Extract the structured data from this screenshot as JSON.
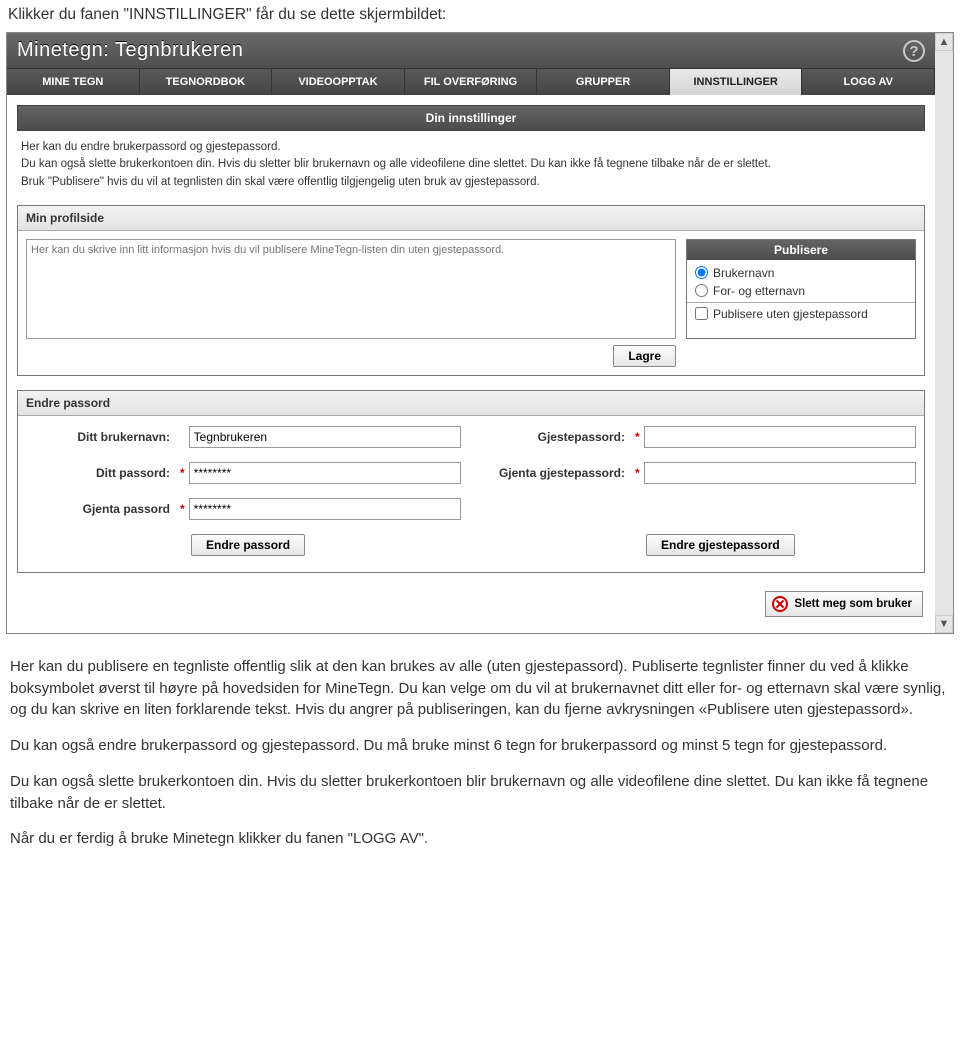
{
  "doc": {
    "intro": "Klikker du fanen \"INNSTILLINGER\" får du se dette skjermbildet:",
    "p1": "Her kan du publisere en tegnliste offentlig slik at den kan brukes av alle (uten gjestepassord). Publiserte tegnlister finner du ved å klikke boksymbolet øverst til høyre på hovedsiden for MineTegn. Du kan velge om du vil at brukernavnet ditt eller for- og etternavn skal være synlig, og du kan skrive en liten forklarende tekst. Hvis du angrer på publiseringen, kan du fjerne avkrysningen «Publisere uten gjestepassord».",
    "p2": "Du kan også endre brukerpassord og gjestepassord. Du må bruke minst 6 tegn for brukerpassord og minst 5 tegn for gjestepassord.",
    "p3": "Du kan også slette brukerkontoen din. Hvis du sletter brukerkontoen blir brukernavn og alle videofilene dine slettet. Du kan ikke få tegnene tilbake når de er slettet.",
    "p4": "Når du er ferdig å bruke Minetegn klikker du fanen \"LOGG AV\"."
  },
  "app": {
    "title": "Minetegn: Tegnbrukeren",
    "help": "?",
    "tabs": [
      "MINE TEGN",
      "TEGNORDBOK",
      "VIDEOOPPTAK",
      "FIL OVERFØRING",
      "GRUPPER",
      "INNSTILLINGER",
      "LOGG AV"
    ],
    "section_header": "Din innstillinger",
    "info": [
      "Her kan du endre brukerpassord og gjestepassord.",
      "Du kan også slette brukerkontoen din. Hvis du sletter blir brukernavn og alle videofilene dine slettet. Du kan ikke få tegnene tilbake når de er slettet.",
      "Bruk \"Publisere\" hvis du vil at tegnlisten din skal være offentlig tilgjengelig uten bruk av gjestepassord."
    ],
    "profile": {
      "title": "Min profilside",
      "placeholder": "Her kan du skrive inn litt informasjon hvis du vil publisere MineTegn-listen din uten gjestepassord.",
      "publish_header": "Publisere",
      "opt_username": "Brukernavn",
      "opt_name": "For- og etternavn",
      "opt_noguest": "Publisere uten gjestepassord",
      "save": "Lagre"
    },
    "password": {
      "title": "Endre passord",
      "username_label": "Ditt brukernavn:",
      "username_value": "Tegnbrukeren",
      "password_label": "Ditt passord:",
      "password_value": "********",
      "repeat_label": "Gjenta passord",
      "repeat_value": "********",
      "guest_label": "Gjestepassord:",
      "repeat_guest_label": "Gjenta gjestepassord:",
      "change_pw": "Endre passord",
      "change_guest": "Endre gjestepassord"
    },
    "delete_label": "Slett meg som bruker",
    "scroll_up": "▲",
    "scroll_down": "▼"
  }
}
